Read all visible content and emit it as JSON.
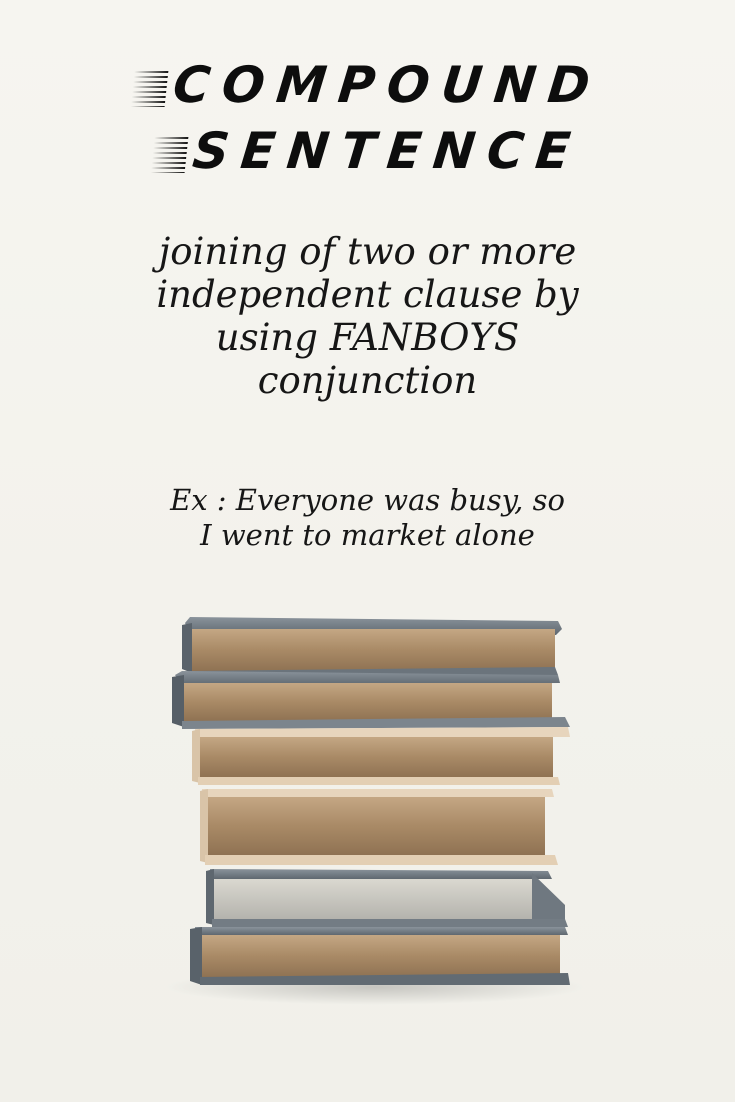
{
  "title": {
    "line1": "COMPOUND",
    "line2": "SENTENCE"
  },
  "definition": {
    "lines": [
      "joining of two or more",
      "independent clause by",
      "using FANBOYS",
      "conjunction"
    ]
  },
  "example": {
    "lines": [
      "Ex : Everyone was busy, so",
      "I went to market alone"
    ]
  },
  "photo": {
    "icon": "stack-of-books-icon"
  },
  "colors": {
    "background": "#f4f3ee",
    "text": "#111111",
    "page_edges": "#b08e68",
    "cover": "#6e7780"
  }
}
